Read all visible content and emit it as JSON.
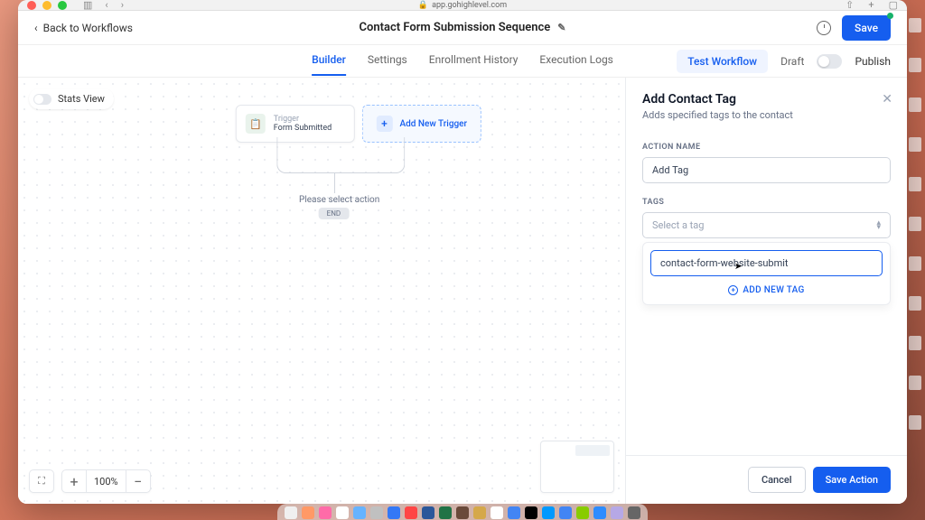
{
  "browser": {
    "url": "app.gohighlevel.com"
  },
  "header": {
    "back": "Back to Workflows",
    "title": "Contact Form Submission Sequence",
    "save": "Save"
  },
  "tabs": {
    "items": [
      "Builder",
      "Settings",
      "Enrollment History",
      "Execution Logs"
    ],
    "test": "Test Workflow",
    "draft": "Draft",
    "publish": "Publish"
  },
  "canvas": {
    "stats_view": "Stats View",
    "trigger_title": "Trigger",
    "trigger_sub": "Form Submitted",
    "add_trigger": "Add New Trigger",
    "select_action": "Please select action",
    "end": "END",
    "zoom": "100%"
  },
  "panel": {
    "title": "Add Contact Tag",
    "subtitle": "Adds specified tags to the contact",
    "action_name_label": "ACTION NAME",
    "action_name_value": "Add Tag",
    "tags_label": "TAGS",
    "tags_placeholder": "Select a tag",
    "tag_input": "contact-form-website-submit",
    "add_new_tag": "ADD NEW TAG",
    "cancel": "Cancel",
    "save_action": "Save Action"
  }
}
